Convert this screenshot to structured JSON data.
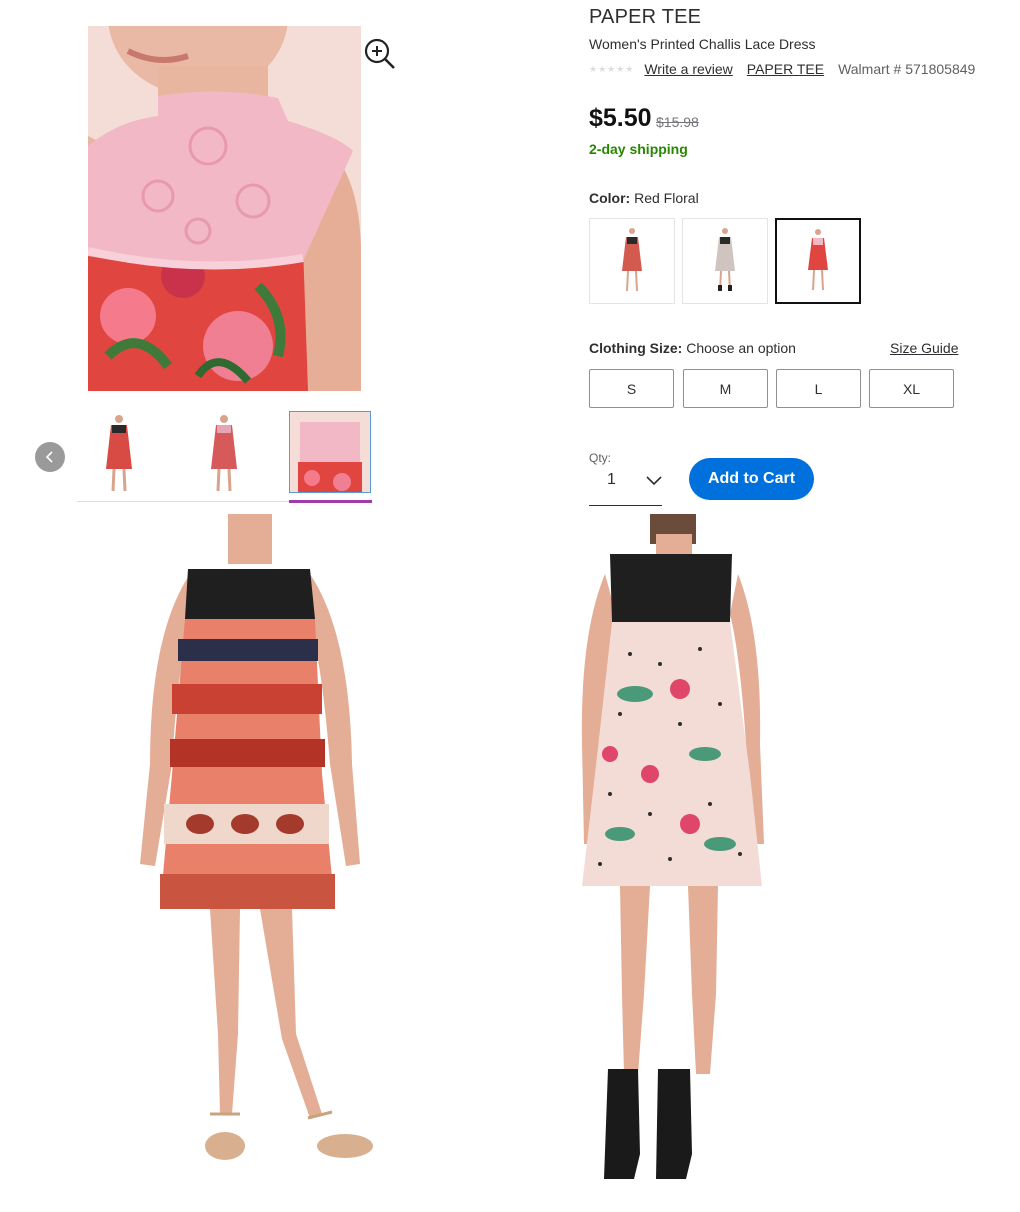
{
  "product": {
    "brand_title": "PAPER TEE",
    "subtitle": "Women's Printed Challis Lace Dress",
    "stars": "★★★★★",
    "write_review": "Write a review",
    "brand_link": "PAPER TEE",
    "item_number": "Walmart # 571805849",
    "price": "$5.50",
    "was_price": "$15.98",
    "shipping": "2-day shipping"
  },
  "color": {
    "label": "Color:",
    "value": "Red Floral"
  },
  "size": {
    "label": "Clothing Size:",
    "value": "Choose an option",
    "guide": "Size Guide",
    "options": [
      "S",
      "M",
      "L",
      "XL"
    ]
  },
  "qty": {
    "label": "Qty:",
    "value": "1"
  },
  "cart": {
    "label": "Add to Cart"
  },
  "icons": {
    "zoom": "zoom-in-icon",
    "prev": "chevron-left-icon",
    "qty": "chevron-down-icon"
  },
  "colors": {
    "accent": "#0071dc",
    "shipping": "#2a8703",
    "thumb_selected": "#a03baa"
  }
}
